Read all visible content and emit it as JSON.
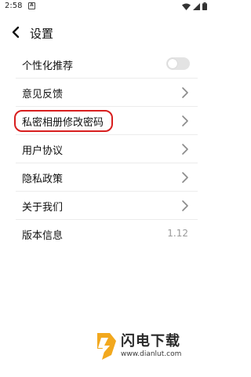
{
  "status_bar": {
    "time": "2:58",
    "notification_icon_letter": "A",
    "icons": [
      "wifi-icon",
      "signal-icon",
      "battery-icon"
    ]
  },
  "header": {
    "back_icon": "chevron-left-icon",
    "title": "设置"
  },
  "settings": {
    "personalized_recommend": {
      "label": "个性化推荐",
      "toggle_on": false
    },
    "feedback": {
      "label": "意见反馈"
    },
    "private_album_password": {
      "label": "私密相册修改密码"
    },
    "user_agreement": {
      "label": "用户协议"
    },
    "privacy_policy": {
      "label": "隐私政策"
    },
    "about_us": {
      "label": "关于我们"
    },
    "version_info": {
      "label": "版本信息",
      "value": "1.12"
    }
  },
  "annotation": {
    "highlight_color": "#d81f1f"
  },
  "watermark": {
    "title": "闪电下载",
    "url": "www.dianlut.com",
    "logo_color": "#f2a81e"
  }
}
